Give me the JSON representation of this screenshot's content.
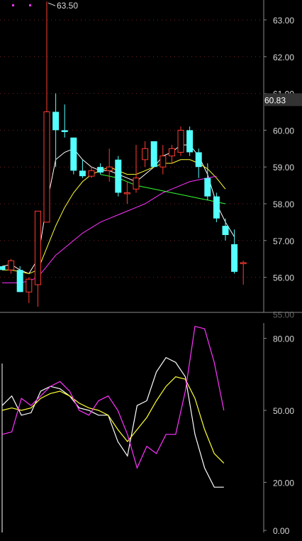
{
  "colors": {
    "background": "#000000",
    "up_candle": "#ff3b30",
    "down_candle": "#54ffff",
    "ma_white": "#ffffff",
    "ma_yellow": "#ffff33",
    "ma_magenta": "#ff33ff",
    "ma_green": "#33ff33",
    "axis": "#8a8a8a",
    "grid": "#7a1f1f",
    "text": "#d8d8d8",
    "price_tag_bg": "#333333"
  },
  "header": {
    "legend_dots": [
      "magenta",
      "magenta"
    ]
  },
  "chart_data": [
    {
      "type": "candlestick",
      "price_tag": "60.83",
      "max_annotation": "63.50",
      "ylim": [
        55.0,
        63.6
      ],
      "y_ticks": [
        "63.00",
        "62.00",
        "61.00",
        "60.00",
        "59.00",
        "58.00",
        "57.00",
        "56.00",
        "55.00"
      ],
      "x": [
        1,
        2,
        3,
        4,
        5,
        6,
        7,
        8,
        9,
        10,
        11,
        12,
        13,
        14,
        15,
        16,
        17,
        18,
        19,
        20,
        21,
        22,
        23,
        24,
        25
      ],
      "candles": [
        {
          "o": 56.3,
          "h": 56.3,
          "l": 56.2,
          "c": 56.2
        },
        {
          "o": 56.2,
          "h": 56.5,
          "l": 56.1,
          "c": 56.45
        },
        {
          "o": 56.2,
          "h": 56.3,
          "l": 55.6,
          "c": 55.6
        },
        {
          "o": 55.6,
          "h": 56.0,
          "l": 55.3,
          "c": 55.95
        },
        {
          "o": 55.8,
          "h": 57.8,
          "l": 55.2,
          "c": 57.8
        },
        {
          "o": 57.5,
          "h": 63.5,
          "l": 57.5,
          "c": 60.5
        },
        {
          "o": 60.5,
          "h": 61.0,
          "l": 59.0,
          "c": 60.0
        },
        {
          "o": 60.0,
          "h": 60.7,
          "l": 59.8,
          "c": 59.95
        },
        {
          "o": 59.8,
          "h": 59.8,
          "l": 58.8,
          "c": 58.9
        },
        {
          "o": 58.9,
          "h": 59.2,
          "l": 58.7,
          "c": 58.75
        },
        {
          "o": 58.75,
          "h": 59.0,
          "l": 58.7,
          "c": 58.9
        },
        {
          "o": 59.0,
          "h": 59.1,
          "l": 58.8,
          "c": 58.85
        },
        {
          "o": 58.9,
          "h": 59.5,
          "l": 58.6,
          "c": 59.0
        },
        {
          "o": 59.2,
          "h": 59.3,
          "l": 58.2,
          "c": 58.3
        },
        {
          "o": 58.3,
          "h": 58.6,
          "l": 58.0,
          "c": 58.3
        },
        {
          "o": 58.4,
          "h": 59.6,
          "l": 58.3,
          "c": 58.7
        },
        {
          "o": 59.2,
          "h": 59.7,
          "l": 59.0,
          "c": 59.5
        },
        {
          "o": 59.7,
          "h": 59.7,
          "l": 59.0,
          "c": 59.0
        },
        {
          "o": 59.0,
          "h": 59.6,
          "l": 58.8,
          "c": 59.3
        },
        {
          "o": 59.3,
          "h": 59.6,
          "l": 59.1,
          "c": 59.5
        },
        {
          "o": 59.4,
          "h": 60.1,
          "l": 59.3,
          "c": 60.0
        },
        {
          "o": 60.0,
          "h": 60.1,
          "l": 59.3,
          "c": 59.4
        },
        {
          "o": 59.4,
          "h": 59.5,
          "l": 58.7,
          "c": 59.0
        },
        {
          "o": 58.7,
          "h": 59.1,
          "l": 58.1,
          "c": 58.2
        },
        {
          "o": 58.2,
          "h": 58.3,
          "l": 57.5,
          "c": 57.6
        },
        {
          "o": 57.4,
          "h": 57.6,
          "l": 57.0,
          "c": 57.15
        },
        {
          "o": 56.9,
          "h": 57.3,
          "l": 56.1,
          "c": 56.15
        },
        {
          "o": 56.4,
          "h": 56.45,
          "l": 55.8,
          "c": 56.4
        }
      ],
      "series": [
        {
          "color": "white",
          "values": [
            56.3,
            56.35,
            56.2,
            56.1,
            56.5,
            58.0,
            59.2,
            59.4,
            59.5,
            59.2,
            59.0,
            58.9,
            58.9,
            58.8,
            58.7,
            58.6,
            58.8,
            59.0,
            59.3,
            59.4,
            59.6,
            59.6,
            59.3,
            58.8,
            58.0,
            57.5,
            57.1,
            null
          ]
        },
        {
          "color": "yellow",
          "values": [
            56.2,
            56.2,
            56.15,
            56.1,
            56.2,
            56.8,
            57.4,
            57.9,
            58.3,
            58.6,
            58.8,
            58.9,
            59.0,
            58.9,
            58.8,
            58.8,
            58.9,
            59.0,
            59.1,
            59.1,
            59.2,
            59.2,
            59.1,
            58.95,
            58.7,
            58.4,
            null,
            null
          ]
        },
        {
          "color": "magenta",
          "values": [
            55.85,
            55.85,
            55.85,
            55.9,
            56.0,
            56.3,
            56.6,
            56.8,
            57.0,
            57.2,
            57.35,
            57.5,
            57.6,
            57.7,
            57.8,
            57.9,
            58.0,
            58.15,
            58.3,
            58.4,
            58.5,
            58.6,
            58.65,
            58.7,
            58.75,
            null,
            null,
            null
          ]
        },
        {
          "color": "green",
          "values": [
            null,
            null,
            null,
            null,
            null,
            null,
            null,
            null,
            null,
            null,
            null,
            58.8,
            58.75,
            58.7,
            58.6,
            58.5,
            58.45,
            58.4,
            58.35,
            58.3,
            58.25,
            58.2,
            58.15,
            58.1,
            58.05,
            58.0,
            null,
            null
          ]
        }
      ]
    },
    {
      "type": "line",
      "ylim": [
        0,
        100
      ],
      "y_ticks": [
        "80.00",
        "50.00",
        "20.00",
        "0.00"
      ],
      "series": [
        {
          "color": "white",
          "values": [
            52,
            56,
            48,
            49,
            58,
            60,
            59,
            56,
            51,
            50,
            48,
            48,
            37,
            31,
            52,
            54,
            66,
            72,
            70,
            64,
            40,
            26,
            18,
            18
          ]
        },
        {
          "color": "yellow",
          "values": [
            50,
            51,
            50,
            51,
            55,
            57,
            58,
            56,
            53,
            51,
            50,
            48,
            42,
            37,
            42,
            47,
            54,
            60,
            64,
            63,
            55,
            42,
            32,
            28
          ]
        },
        {
          "color": "magenta",
          "values": [
            40,
            41,
            55,
            52,
            56,
            60,
            62,
            58,
            50,
            48,
            54,
            56,
            50,
            40,
            26,
            35,
            32,
            40,
            40,
            58,
            85,
            84,
            70,
            50
          ]
        }
      ]
    }
  ]
}
